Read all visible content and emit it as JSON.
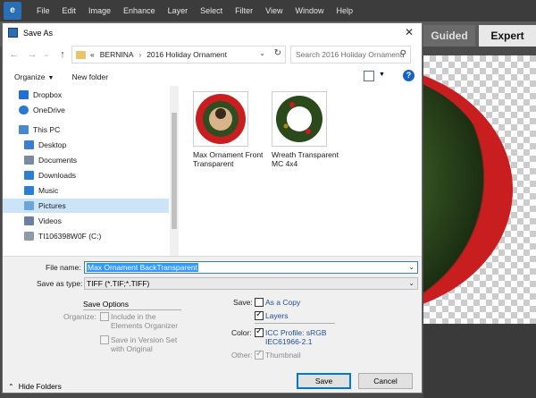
{
  "app": {
    "menu": [
      "File",
      "Edit",
      "Image",
      "Enhance",
      "Layer",
      "Select",
      "Filter",
      "View",
      "Window",
      "Help"
    ],
    "modes": {
      "guided": "Guided",
      "expert": "Expert"
    }
  },
  "dialog": {
    "title": "Save As",
    "address": {
      "prefix": "«",
      "crumbs": [
        "BERNINA",
        "2016 Holiday Ornament"
      ]
    },
    "search_placeholder": "Search 2016 Holiday Ornament",
    "toolbar": {
      "organize": "Organize",
      "new_folder": "New folder"
    },
    "nav_items": [
      {
        "label": "Dropbox",
        "icon": "dropbox-icon",
        "color": "#1f6fd6"
      },
      {
        "label": "OneDrive",
        "icon": "onedrive-icon",
        "color": "#2a78d6"
      },
      {
        "label": "This PC",
        "icon": "computer-icon",
        "color": "#4a89c9"
      },
      {
        "label": "Desktop",
        "icon": "desktop-icon",
        "color": "#3b7ed1"
      },
      {
        "label": "Documents",
        "icon": "documents-icon",
        "color": "#7a8aa0"
      },
      {
        "label": "Downloads",
        "icon": "downloads-icon",
        "color": "#2f7fd0"
      },
      {
        "label": "Music",
        "icon": "music-icon",
        "color": "#2f7fd0"
      },
      {
        "label": "Pictures",
        "icon": "pictures-icon",
        "color": "#6aa7d8"
      },
      {
        "label": "Videos",
        "icon": "videos-icon",
        "color": "#6d7fa0"
      },
      {
        "label": "TI106398W0F (C:)",
        "icon": "drive-icon",
        "color": "#8f9aa8"
      }
    ],
    "files": [
      {
        "label": "Max Ornament Front Transparent"
      },
      {
        "label": "Wreath Transparent MC 4x4"
      }
    ],
    "form": {
      "file_name_label": "File name:",
      "file_name_value": "Max Ornament BackTransparent",
      "save_as_type_label": "Save as type:",
      "save_as_type_value": "TIFF (*.TIF;*.TIFF)",
      "save_options_title": "Save Options",
      "organize_label": "Organize:",
      "include_organizer": "Include in the Elements Organizer",
      "save_version_set": "Save in Version Set with Original",
      "save_label": "Save:",
      "as_a_copy": "As a Copy",
      "layers": "Layers",
      "color_label": "Color:",
      "icc_profile": "ICC Profile:  sRGB IEC61966-2.1",
      "other_label": "Other:",
      "thumbnail": "Thumbnail"
    },
    "buttons": {
      "hide_folders": "Hide Folders",
      "save": "Save",
      "cancel": "Cancel"
    }
  }
}
